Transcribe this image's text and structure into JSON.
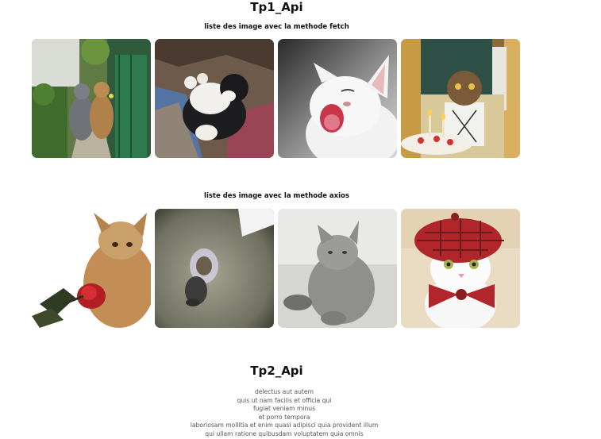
{
  "tp1": {
    "title": "Tp1_Api",
    "fetch_heading": "liste des image avec la methode fetch",
    "axios_heading": "liste des image avec la methode axios"
  },
  "tp2": {
    "title": "Tp2_Api",
    "items": [
      "delectus aut autem",
      "quis ut nam facilis et officia qui",
      "fugiat veniam minus",
      "et porro tempora",
      "laboriosam mollitia et enim quasi adipisci quia provident illum",
      "qui ullam ratione quibusdam voluptatem quia omnis"
    ]
  }
}
